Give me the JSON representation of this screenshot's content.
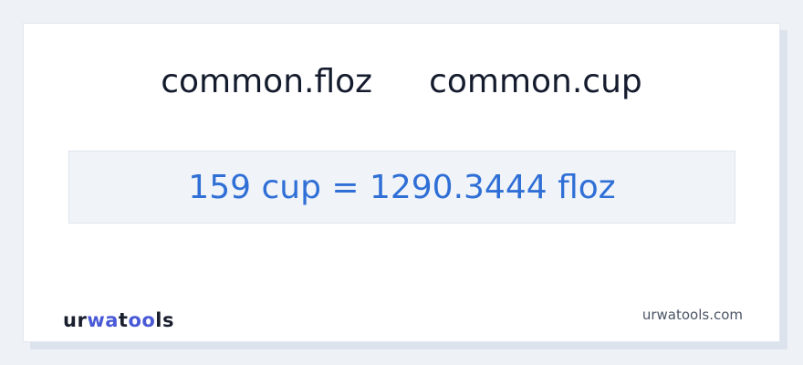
{
  "header": {
    "unit_from": "common.floz",
    "unit_to": "common.cup"
  },
  "result": {
    "text": "159 cup = 1290.3444 floz"
  },
  "branding": {
    "logo_part1": "ur",
    "logo_part2": "wa",
    "logo_part3": "t",
    "logo_part4": "oo",
    "logo_part5": "ls",
    "domain": "urwatools.com",
    "accent_color": "#4a5ad6"
  },
  "colors": {
    "result_text": "#2f6fd6",
    "heading_text": "#141b2d",
    "background": "#eef1f6"
  }
}
